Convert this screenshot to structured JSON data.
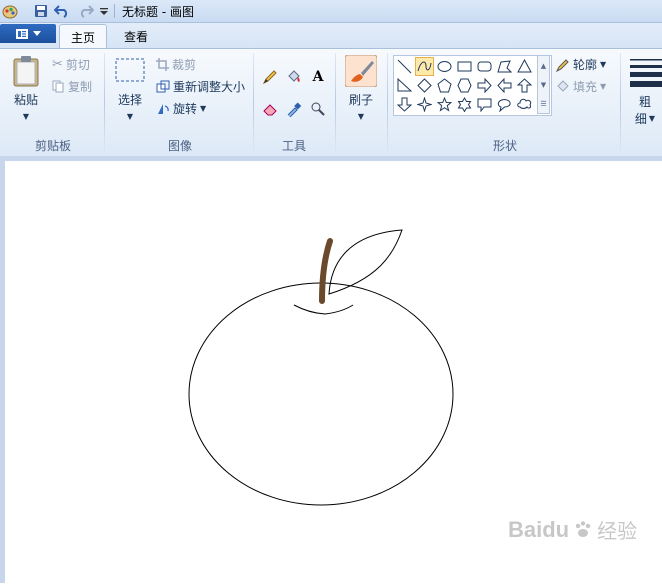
{
  "window": {
    "title": "无标题 - 画图"
  },
  "tabs": [
    {
      "label": "主页"
    },
    {
      "label": "查看"
    }
  ],
  "clipboard": {
    "paste_label": "粘贴",
    "cut_label": "剪切",
    "copy_label": "复制",
    "group_label": "剪贴板"
  },
  "image": {
    "select_label": "选择",
    "crop_label": "裁剪",
    "resize_label": "重新调整大小",
    "rotate_label": "旋转",
    "group_label": "图像"
  },
  "tools": {
    "group_label": "工具"
  },
  "brushes": {
    "label": "刷子"
  },
  "shapes": {
    "outline_label": "轮廓",
    "fill_label": "填充",
    "group_label": "形状",
    "selected": "curve"
  },
  "size": {
    "label_line1": "粗",
    "label_line2": "细"
  },
  "watermark": {
    "text": "经验",
    "brand": "Baidu"
  }
}
